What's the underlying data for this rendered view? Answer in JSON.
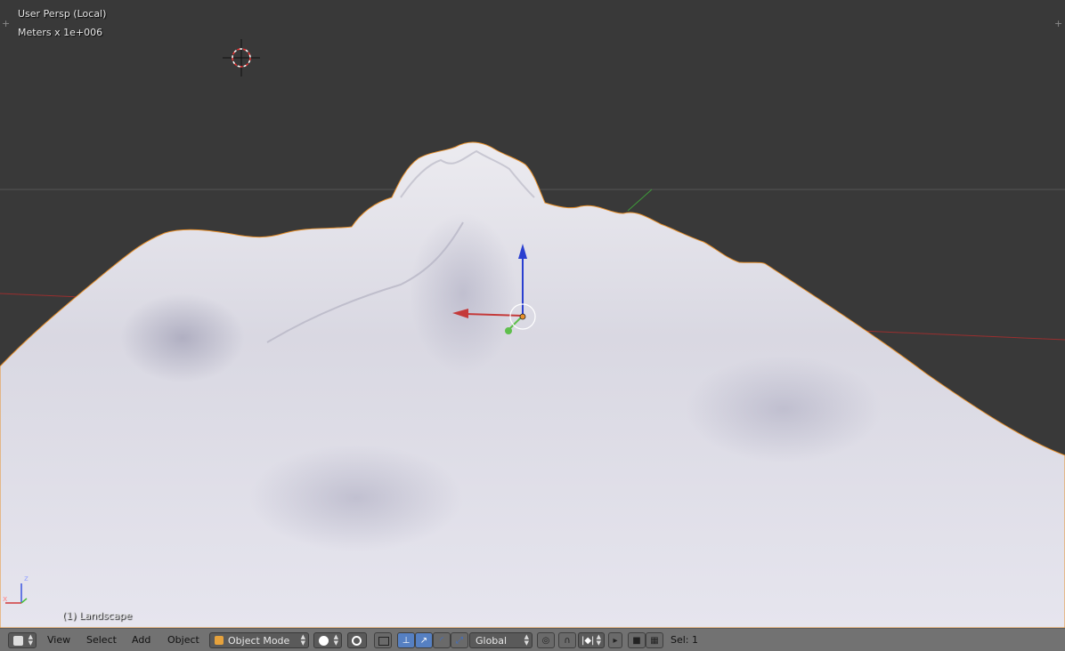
{
  "viewport": {
    "view_name": "User Persp (Local)",
    "grid_scale": "Meters x 1e+006",
    "active_object": "(1) Landscape",
    "axis_labels": {
      "z": "z",
      "x": "x"
    },
    "colors": {
      "background": "#393939",
      "terrain": "#dedde6",
      "x_axis": "#c43a3a",
      "y_axis": "#5fbf4c",
      "z_axis": "#2a3fd0",
      "selection_outline": "#e8902a"
    }
  },
  "header": {
    "editor_type_icon": "3d-view-icon",
    "menus": [
      "View",
      "Select",
      "Add",
      "Object"
    ],
    "mode": {
      "icon": "object-mode-cube-icon",
      "label": "Object Mode"
    },
    "shading_icon": "solid-sphere-icon",
    "pivot_icon": "pivot-point-icon",
    "layer_icon": "layers-icon",
    "manipulator_icons": [
      "manipulator-toggle-icon",
      "translate-icon",
      "rotate-icon",
      "scale-icon"
    ],
    "orientation": {
      "label": "Global"
    },
    "proportional_icon": "proportional-edit-icon",
    "snap_icons": [
      "snap-magnet-icon",
      "snap-element-icon"
    ],
    "render_icons": [
      "render-camera-icon",
      "render-clapper-icon"
    ],
    "selection_status": "Sel: 1"
  }
}
